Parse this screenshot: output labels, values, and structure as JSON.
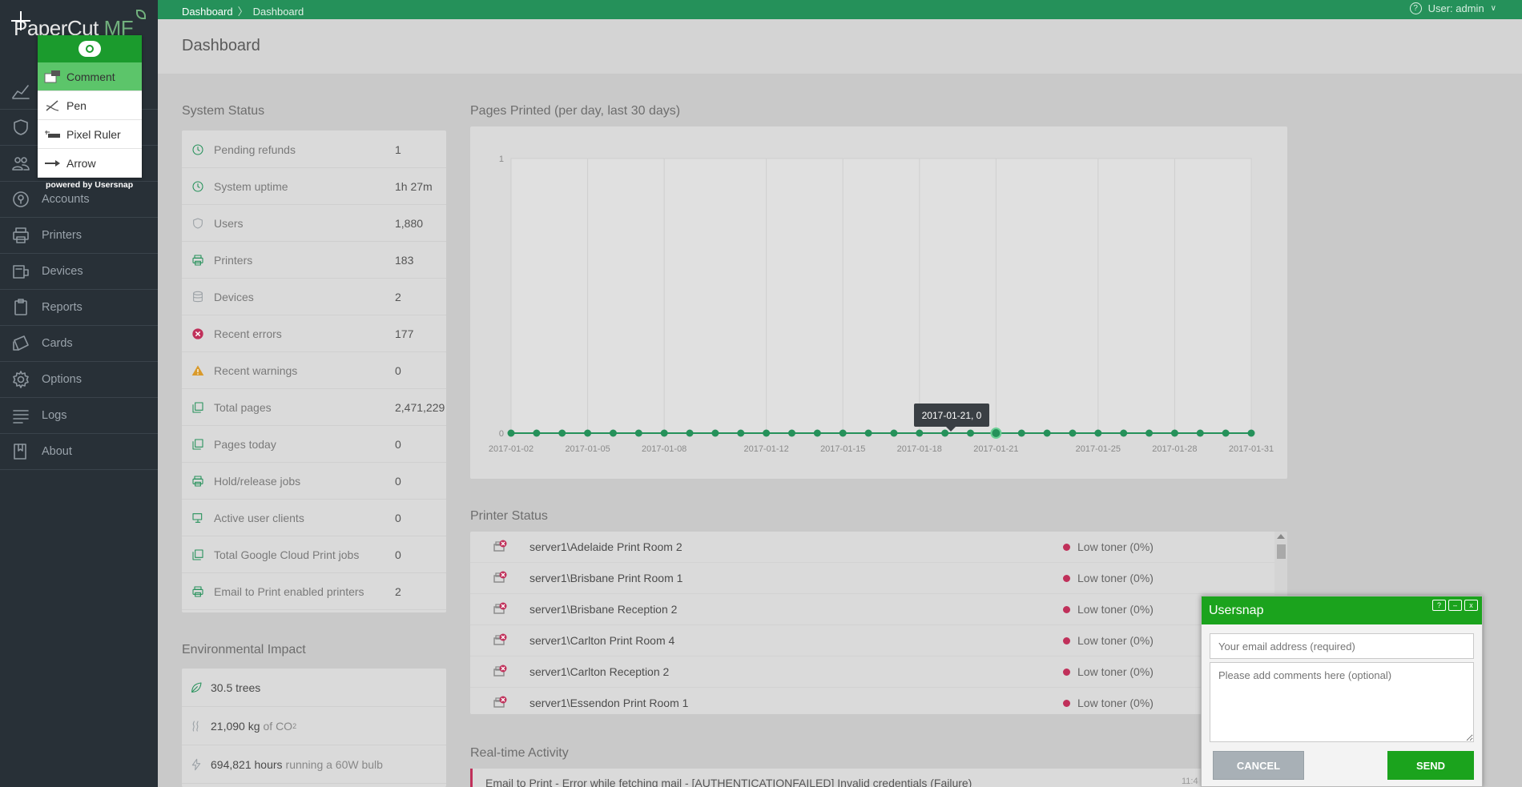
{
  "app": {
    "logo": {
      "text": "PaperCut",
      "suffix": "MF"
    }
  },
  "topbar": {
    "breadcrumb": [
      "Dashboard",
      "Dashboard"
    ],
    "user": "User: admin"
  },
  "page_title": "Dashboard",
  "sidebar": {
    "items": [
      {
        "label": "",
        "icon": "chart-line-icon"
      },
      {
        "label": "",
        "icon": "shield-icon"
      },
      {
        "label": "",
        "icon": "users-icon"
      },
      {
        "label": "Accounts",
        "icon": "accounts-icon"
      },
      {
        "label": "Printers",
        "icon": "printer-icon"
      },
      {
        "label": "Devices",
        "icon": "device-icon"
      },
      {
        "label": "Reports",
        "icon": "clipboard-icon"
      },
      {
        "label": "Cards",
        "icon": "cards-icon"
      },
      {
        "label": "Options",
        "icon": "gear-icon"
      },
      {
        "label": "Logs",
        "icon": "list-icon"
      },
      {
        "label": "About",
        "icon": "book-icon"
      }
    ]
  },
  "system_status": {
    "title": "System Status",
    "rows": [
      {
        "label": "Pending refunds",
        "value": "1",
        "icon": "clock-icon"
      },
      {
        "label": "System uptime",
        "value": "1h 27m",
        "icon": "clock-icon"
      },
      {
        "label": "Users",
        "value": "1,880",
        "icon": "shield-icon"
      },
      {
        "label": "Printers",
        "value": "183",
        "icon": "printer-icon"
      },
      {
        "label": "Devices",
        "value": "2",
        "icon": "database-icon"
      },
      {
        "label": "Recent errors",
        "value": "177",
        "icon": "error-icon"
      },
      {
        "label": "Recent warnings",
        "value": "0",
        "icon": "warning-icon"
      },
      {
        "label": "Total pages",
        "value": "2,471,229",
        "icon": "pages-icon"
      },
      {
        "label": "Pages today",
        "value": "0",
        "icon": "pages-icon"
      },
      {
        "label": "Hold/release jobs",
        "value": "0",
        "icon": "printer-icon"
      },
      {
        "label": "Active user clients",
        "value": "0",
        "icon": "monitor-icon"
      },
      {
        "label": "Total Google Cloud Print jobs",
        "value": "0",
        "icon": "pages-icon"
      },
      {
        "label": "Email to Print enabled printers",
        "value": "2",
        "icon": "printer-icon"
      }
    ]
  },
  "environmental": {
    "title": "Environmental Impact",
    "rows": [
      {
        "value": "30.5 trees",
        "suffix": "",
        "icon": "leaf-icon"
      },
      {
        "value": "21,090 kg",
        "suffix": "of CO",
        "sub": "2",
        "icon": "steam-icon"
      },
      {
        "value": "694,821 hours",
        "suffix": "running a 60W bulb",
        "icon": "bolt-icon"
      }
    ]
  },
  "pages_chart_title": "Pages Printed (per day, last 30 days)",
  "chart_data": {
    "type": "line",
    "x": [
      "2017-01-02",
      "2017-01-03",
      "2017-01-04",
      "2017-01-05",
      "2017-01-06",
      "2017-01-07",
      "2017-01-08",
      "2017-01-09",
      "2017-01-10",
      "2017-01-11",
      "2017-01-12",
      "2017-01-13",
      "2017-01-14",
      "2017-01-15",
      "2017-01-16",
      "2017-01-17",
      "2017-01-18",
      "2017-01-19",
      "2017-01-20",
      "2017-01-21",
      "2017-01-22",
      "2017-01-23",
      "2017-01-24",
      "2017-01-25",
      "2017-01-26",
      "2017-01-27",
      "2017-01-28",
      "2017-01-29",
      "2017-01-30",
      "2017-01-31"
    ],
    "values": [
      0,
      0,
      0,
      0,
      0,
      0,
      0,
      0,
      0,
      0,
      0,
      0,
      0,
      0,
      0,
      0,
      0,
      0,
      0,
      0,
      0,
      0,
      0,
      0,
      0,
      0,
      0,
      0,
      0,
      0
    ],
    "x_tick_labels": [
      "2017-01-02",
      "2017-01-05",
      "2017-01-08",
      "2017-01-12",
      "2017-01-15",
      "2017-01-18",
      "2017-01-21",
      "2017-01-25",
      "2017-01-28",
      "2017-01-31"
    ],
    "y_tick_labels": [
      "0",
      "1"
    ],
    "ylim": [
      0,
      1
    ],
    "grid": true,
    "color": "#25915a",
    "tooltip": "2017-01-21, 0"
  },
  "printer_status": {
    "title": "Printer Status",
    "rows": [
      {
        "name": "server1\\Adelaide Print Room 2",
        "status": "Low toner (0%)"
      },
      {
        "name": "server1\\Brisbane Print Room 1",
        "status": "Low toner (0%)"
      },
      {
        "name": "server1\\Brisbane Reception 2",
        "status": "Low toner (0%)"
      },
      {
        "name": "server1\\Carlton Print Room 4",
        "status": "Low toner (0%)"
      },
      {
        "name": "server1\\Carlton Reception 2",
        "status": "Low toner (0%)"
      },
      {
        "name": "server1\\Essendon Print Room 1",
        "status": "Low toner (0%)"
      }
    ]
  },
  "activity": {
    "title": "Real-time Activity",
    "first_entry": "Email to Print - Error while fetching mail - [AUTHENTICATIONFAILED] Invalid credentials (Failure)",
    "first_time": "11:4"
  },
  "usersnap_menu": {
    "tools": [
      {
        "label": "Comment",
        "icon": "comment-icon"
      },
      {
        "label": "Pen",
        "icon": "pen-icon"
      },
      {
        "label": "Pixel Ruler",
        "icon": "ruler-icon"
      },
      {
        "label": "Arrow",
        "icon": "arrow-icon"
      }
    ],
    "powered_by": "powered by Usersnap"
  },
  "usersnap_feedback": {
    "title": "Usersnap",
    "controls": [
      "?",
      "–",
      "x"
    ],
    "email_placeholder": "Your email address (required)",
    "comment_placeholder": "Please add comments here (optional)",
    "cancel_label": "CANCEL",
    "send_label": "SEND"
  },
  "colors": {
    "topbar": "#25915a",
    "sidebar": "#283037",
    "usersnap_green": "#1ba31d",
    "error_dot": "#c0305a"
  }
}
